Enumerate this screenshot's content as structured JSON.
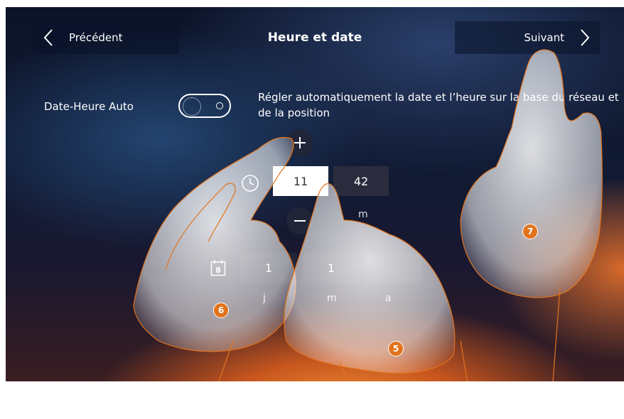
{
  "header": {
    "back_label": "Précédent",
    "title": "Heure et date",
    "next_label": "Suivant"
  },
  "auto": {
    "label": "Date-Heure Auto",
    "toggle_state": "off",
    "description": "Régler automatiquement la date et l’heure sur la base du réseau et de la position"
  },
  "time": {
    "hour": "11",
    "minute": "42",
    "minute_unit": "m"
  },
  "date": {
    "day": "1",
    "month": "1",
    "year": "",
    "day_label": "j",
    "month_label": "m",
    "year_label": "a",
    "calendar_number": "8"
  },
  "markers": {
    "m5": "5",
    "m6": "6",
    "m7": "7"
  },
  "colors": {
    "marker": "#e2731d",
    "hand_outline": "#e2731d",
    "selected_field": "#ffffff"
  },
  "icons": [
    "chevron-left-icon",
    "chevron-right-icon",
    "plus-icon",
    "minus-icon",
    "clock-icon",
    "calendar-icon"
  ]
}
